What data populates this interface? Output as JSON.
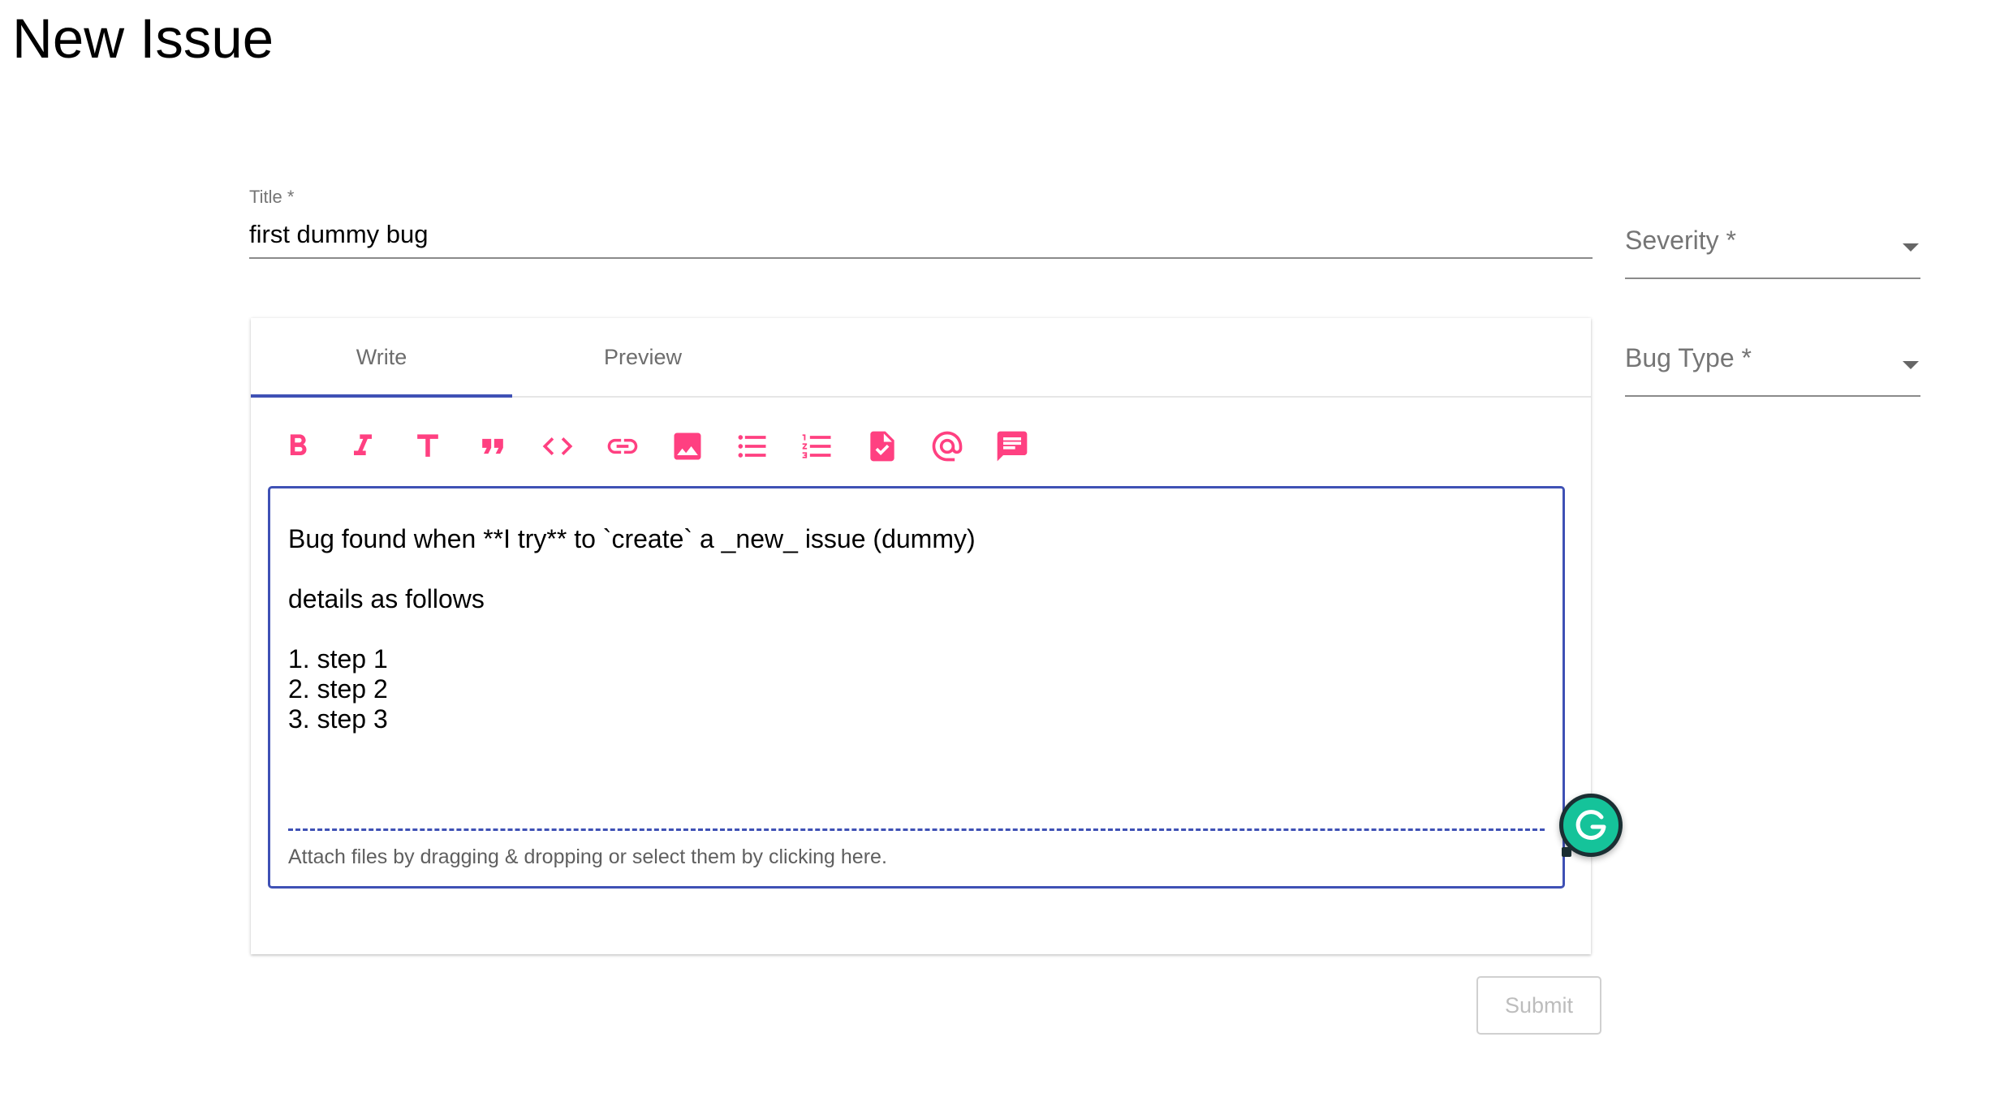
{
  "page": {
    "title": "New Issue"
  },
  "title_field": {
    "label": "Title *",
    "value": "first dummy bug"
  },
  "severity": {
    "label": "Severity *"
  },
  "bug_type": {
    "label": "Bug Type *"
  },
  "tabs": [
    {
      "label": "Write",
      "active": true
    },
    {
      "label": "Preview",
      "active": false
    }
  ],
  "toolbar": [
    {
      "name": "bold-icon"
    },
    {
      "name": "italic-icon"
    },
    {
      "name": "header-icon"
    },
    {
      "name": "quote-icon"
    },
    {
      "name": "code-icon"
    },
    {
      "name": "link-icon"
    },
    {
      "name": "image-icon"
    },
    {
      "name": "unordered-list-icon"
    },
    {
      "name": "ordered-list-icon"
    },
    {
      "name": "checked-list-icon"
    },
    {
      "name": "mention-icon"
    },
    {
      "name": "saved-reply-icon"
    }
  ],
  "editor": {
    "content": "Bug found when **I try** to `create` a _new_ issue (dummy)\n\ndetails as follows\n\n1. step 1\n2. step 2\n3. step 3",
    "attach_hint": "Attach files by dragging & dropping or select them by clicking here."
  },
  "submit": {
    "label": "Submit",
    "disabled": true
  },
  "colors": {
    "accent": "#3f51b5",
    "toolbar_icon": "#ff4081",
    "grammarly": "#15c39a"
  }
}
